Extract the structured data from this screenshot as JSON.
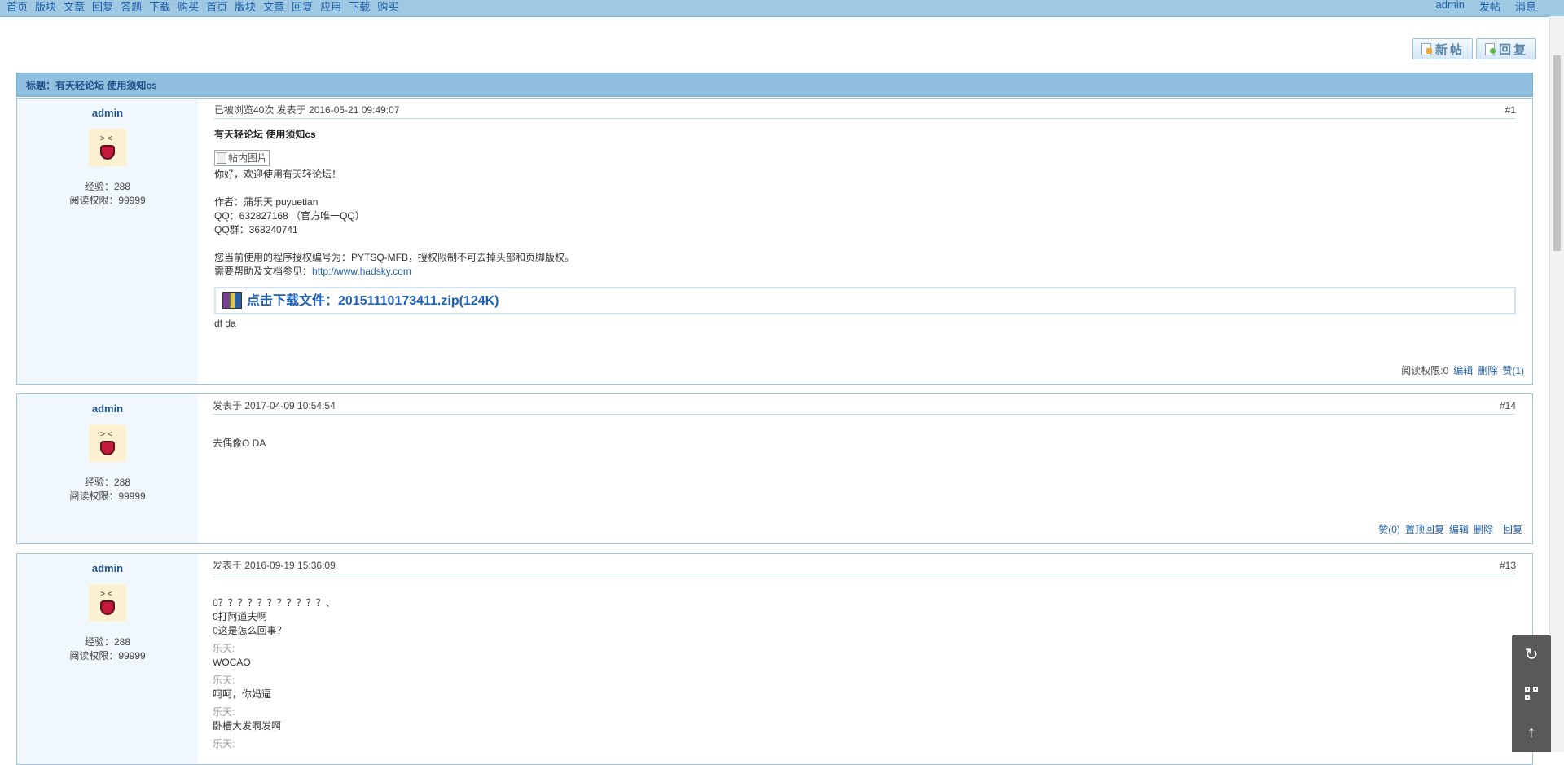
{
  "nav": {
    "left_items": [
      "首页",
      "版块",
      "文章",
      "回复",
      "答题",
      "下载",
      "购买",
      "首页",
      "版块",
      "文章",
      "回复",
      "应用",
      "下载",
      "购买"
    ],
    "right_items": [
      "admin",
      "发帖",
      "消息"
    ]
  },
  "toolbar": {
    "new_post": "新帖",
    "reply": "回复"
  },
  "title": "标题：有天轻论坛 使用须知cs",
  "posts": [
    {
      "author": "admin",
      "exp": "经验：288",
      "read_perm": "阅读权限：99999",
      "head": "已被浏览40次 发表于 2016-05-21 09:49:07",
      "floor": "#1",
      "subject": "有天轻论坛 使用须知cs",
      "image_alt": "帖内图片",
      "lines": [
        "你好，欢迎使用有天轻论坛！",
        "",
        "作者：蒲乐天 puyuetian",
        "QQ：632827168 （官方唯一QQ）",
        "QQ群：368240741",
        "",
        "您当前使用的程序授权编号为：PYTSQ-MFB，授权限制不可去掉头部和页脚版权。"
      ],
      "help_prefix": "需要帮助及文档参见：",
      "help_link": "http://www.hadsky.com",
      "download": "点击下载文件：20151110173411.zip(124K)",
      "after": "df da",
      "foot": {
        "perm": "阅读权限:0",
        "edit": "编辑",
        "delete": "删除",
        "like": "赞(1)"
      }
    },
    {
      "author": "admin",
      "exp": "经验：288",
      "read_perm": "阅读权限：99999",
      "head": "发表于 2017-04-09 10:54:54",
      "floor": "#14",
      "text": "去偶像O DA",
      "foot": {
        "like": "赞(0)",
        "pin": "置顶回复",
        "edit": "编辑",
        "delete": "删除",
        "reply": "回复"
      }
    },
    {
      "author": "admin",
      "exp": "经验：288",
      "read_perm": "阅读权限：99999",
      "head": "发表于 2016-09-19 15:36:09",
      "floor": "#13",
      "lines": [
        "0？？？？？？？？？？？、",
        "0打阿道夫啊",
        "0这是怎么回事？"
      ],
      "quotes": [
        {
          "label": "乐天:",
          "text": "WOCAO"
        },
        {
          "label": "乐天:",
          "text": "呵呵，你妈逼"
        },
        {
          "label": "乐天:",
          "text": "卧槽大发啊发啊"
        },
        {
          "label": "乐天:",
          "text": ""
        }
      ]
    }
  ],
  "float_tools": [
    "refresh-icon",
    "qrcode-icon",
    "back-to-top-icon"
  ]
}
